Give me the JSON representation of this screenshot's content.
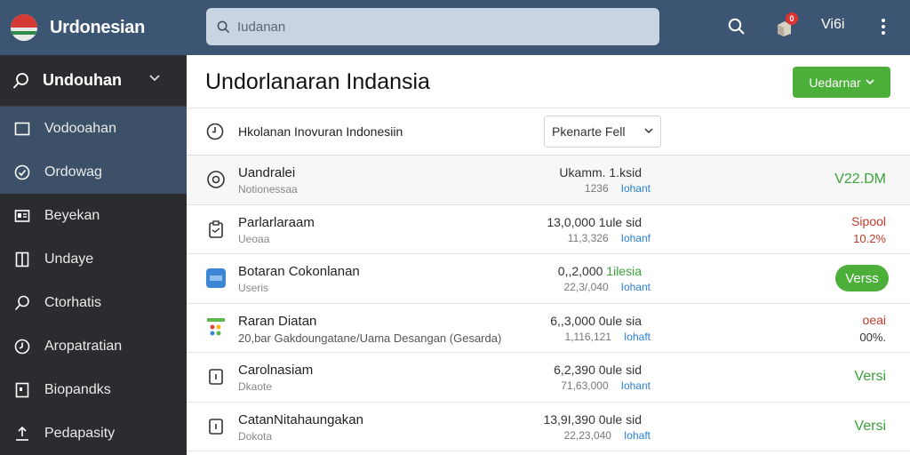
{
  "app": {
    "title": "Urdonesian",
    "search_placeholder": "Iudanan",
    "notif_count": "0",
    "user_label": "Vi6i"
  },
  "sidebar": {
    "header": "Undouhan",
    "items": [
      {
        "label": "Vodooahan",
        "icon": "square-icon",
        "active": true
      },
      {
        "label": "Ordowag",
        "icon": "clock-icon",
        "active": true
      },
      {
        "label": "Beyekan",
        "icon": "id-card-icon",
        "active": false
      },
      {
        "label": "Undaye",
        "icon": "panel-icon",
        "active": false
      },
      {
        "label": "Ctorhatis",
        "icon": "search-icon",
        "active": false
      },
      {
        "label": "Aropatratian",
        "icon": "clock-icon",
        "active": false
      },
      {
        "label": "Biopandks",
        "icon": "doc-icon",
        "active": false
      },
      {
        "label": "Pedapasity",
        "icon": "upload-icon",
        "active": false
      }
    ]
  },
  "main": {
    "title": "Undorlanaran Indansia",
    "primary_button": "Uedarnar",
    "filter_label": "Hkolanan Inovuran Indonesiin",
    "select_value": "Pkenarte Fell",
    "rows": [
      {
        "name": "Uandralei",
        "sub": "Notionessaa",
        "mid1": "Ukamm. 1.ksid",
        "mid1_green": "",
        "mid2": "1236",
        "link": "Iohant",
        "amount": "V22.DM",
        "kind": "green"
      },
      {
        "name": "Parlarlaraam",
        "sub": "Ueoaa",
        "mid1": "13,0,000 1ule sid",
        "mid1_green": "",
        "mid2": "11,3,326",
        "link": "Iohanf",
        "amount_a": "Sipool",
        "amount_b": "10.2%",
        "kind": "red"
      },
      {
        "name": "Botaran Cokonlanan",
        "sub": "Useris",
        "mid1": "0,,2,000 ",
        "mid1_green": "1ilesia",
        "mid2": "22,3/,040",
        "link": "Iohant",
        "amount": "Verss",
        "kind": "pill"
      },
      {
        "name": "Raran Diatan",
        "sub": "20,bar Gakdoungatane/Uama Desangan (Gesarda)",
        "mid1": "6,,3,000 0ule sia",
        "mid1_green": "",
        "mid2": "1,116,121",
        "link": "Iohaft",
        "amount_a": "oeai",
        "amount_b": "00%.",
        "kind": "red-dark"
      },
      {
        "name": "Carolnasiam",
        "sub": "Dkaote",
        "mid1": "6,2,390 0ule sid",
        "mid1_green": "",
        "mid2": "71,63,000",
        "link": "Iohant",
        "amount": "Versi",
        "kind": "green"
      },
      {
        "name": "CatanNitahaungakan",
        "sub": "Dokota",
        "mid1": "13,9I,390 0ule sid",
        "mid1_green": "",
        "mid2": "22,23,040",
        "link": "Iohaft",
        "amount": "Versi",
        "kind": "green"
      }
    ]
  },
  "colors": {
    "topbar": "#3b5573",
    "sidebar": "#2a2c2f",
    "sidebar_active": "#3c5168",
    "accent_green": "#4caf3a",
    "link_blue": "#2a7fd4",
    "negative_red": "#c0392b"
  }
}
